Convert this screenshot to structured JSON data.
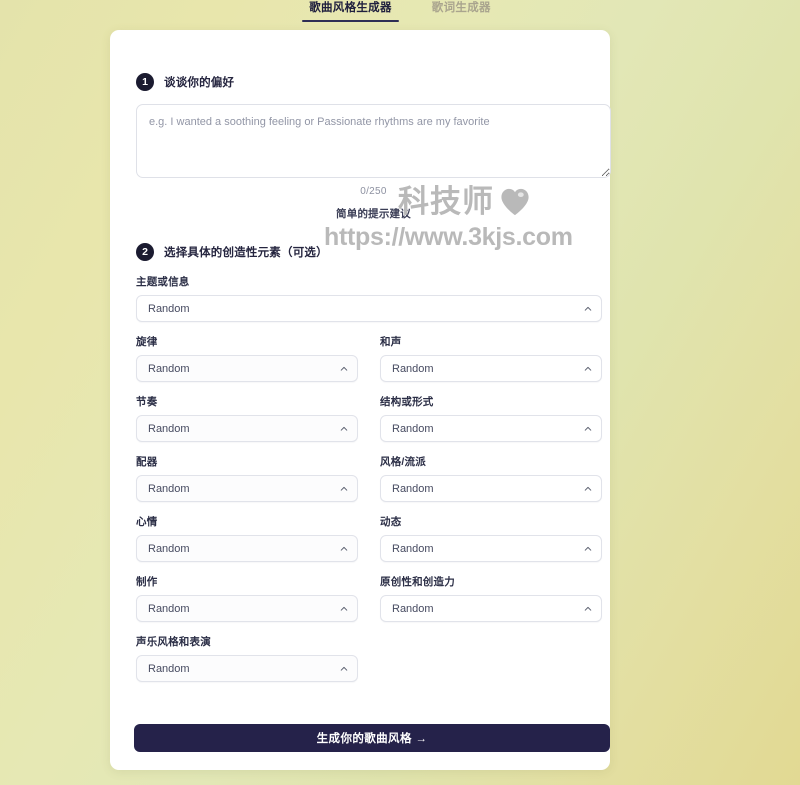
{
  "tabs": [
    {
      "label": "歌曲风格生成器",
      "active": true
    },
    {
      "label": "歌词生成器",
      "active": false
    }
  ],
  "step1": {
    "number": "1",
    "title": "谈谈你的偏好",
    "textarea_placeholder": "e.g. I wanted a soothing feeling or Passionate rhythms are my favorite",
    "textarea_value": "",
    "counter": "0/250",
    "hint": "简单的提示建议"
  },
  "step2": {
    "number": "2",
    "title": "选择具体的创造性元素（可选）",
    "topic_field": {
      "label": "主题或信息",
      "value": "Random"
    },
    "fields": [
      {
        "label": "旋律",
        "value": "Random"
      },
      {
        "label": "和声",
        "value": "Random"
      },
      {
        "label": "节奏",
        "value": "Random"
      },
      {
        "label": "结构或形式",
        "value": "Random"
      },
      {
        "label": "配器",
        "value": "Random"
      },
      {
        "label": "风格/流派",
        "value": "Random"
      },
      {
        "label": "心情",
        "value": "Random"
      },
      {
        "label": "动态",
        "value": "Random"
      },
      {
        "label": "制作",
        "value": "Random"
      },
      {
        "label": "原创性和创造力",
        "value": "Random"
      },
      {
        "label": "声乐风格和表演",
        "value": "Random"
      }
    ]
  },
  "submit": {
    "label": "生成你的歌曲风格 →"
  },
  "watermark": {
    "brand": "科技师",
    "url": "https://www.3kjs.com"
  },
  "colors": {
    "accent_dark": "#25224a",
    "badge": "#1b1b30",
    "tab_active": "#20203e",
    "tab_inactive": "#a9a48e",
    "watermark": "#b9b9b9"
  }
}
